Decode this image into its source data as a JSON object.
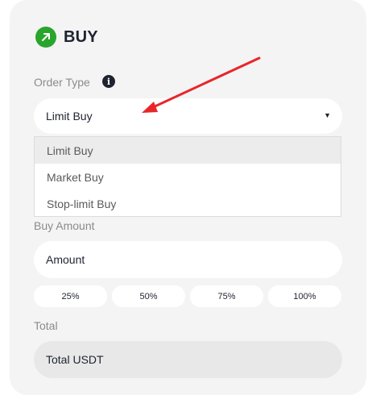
{
  "buy_section": {
    "title": "BUY",
    "icon": "arrow-up-right-icon",
    "accent_color": "#2aa52c"
  },
  "order_type": {
    "label": "Order Type",
    "info_icon": "info-icon",
    "selected_value": "Limit Buy",
    "options": [
      "Limit Buy",
      "Market Buy",
      "Stop-limit Buy"
    ]
  },
  "buy_amount": {
    "label": "Buy Amount",
    "placeholder": "Amount",
    "percent_buttons": [
      "25%",
      "50%",
      "75%",
      "100%"
    ]
  },
  "total": {
    "label": "Total",
    "placeholder": "Total USDT"
  },
  "annotation": {
    "arrow_color": "#e8262a"
  }
}
